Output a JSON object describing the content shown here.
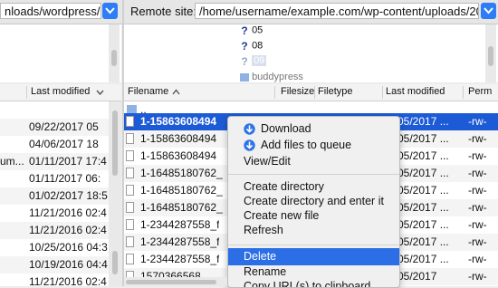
{
  "local": {
    "path_value": "nloads/wordpress/",
    "headers": {
      "last_modified": "Last modified"
    },
    "rows": [
      {
        "name": "",
        "modified": ""
      },
      {
        "name": "",
        "modified": "09/22/2017 05"
      },
      {
        "name": "",
        "modified": "04/06/2017 18"
      },
      {
        "name": "um...",
        "modified": "01/11/2017 17:4"
      },
      {
        "name": "",
        "modified": "01/11/2017 06:"
      },
      {
        "name": "",
        "modified": "01/02/2017 18:5"
      },
      {
        "name": "",
        "modified": "11/21/2016 02:4"
      },
      {
        "name": "",
        "modified": "11/21/2016 02:4"
      },
      {
        "name": "",
        "modified": "10/25/2016 04:3"
      },
      {
        "name": "",
        "modified": "10/19/2016 04:4"
      },
      {
        "name": "",
        "modified": "11/21/2016 02:4"
      }
    ]
  },
  "remote": {
    "site_label": "Remote site:",
    "path_value": "/home/username/example.com/wp-content/uploads/20",
    "tree": [
      {
        "label": "05",
        "icon": "question-folder-icon"
      },
      {
        "label": "08",
        "icon": "question-folder-icon"
      },
      {
        "label": "09",
        "icon": "question-folder-icon"
      },
      {
        "label": "buddypress",
        "icon": "folder-icon"
      }
    ],
    "headers": {
      "filename": "Filename",
      "sort_arrow": "^",
      "filesize": "Filesize",
      "filetype": "Filetype",
      "last_modified": "Last modified",
      "permissions": "Perm"
    },
    "rows": [
      {
        "name": "..",
        "modified": "",
        "perm": "",
        "folder": true,
        "selected": false
      },
      {
        "name": "1-15863608494",
        "modified": "05/2017 ...",
        "perm": "-rw-",
        "selected": true
      },
      {
        "name": "1-15863608494",
        "modified": "05/2017 ...",
        "perm": "-rw-",
        "selected": false
      },
      {
        "name": "1-15863608494",
        "modified": "05/2017 ...",
        "perm": "-rw-",
        "selected": false
      },
      {
        "name": "1-16485180762_",
        "modified": "05/2017 ...",
        "perm": "-rw-",
        "selected": false
      },
      {
        "name": "1-16485180762_",
        "modified": "05/2017 ...",
        "perm": "-rw-",
        "selected": false
      },
      {
        "name": "1-16485180762_",
        "modified": "05/2017 ...",
        "perm": "-rw-",
        "selected": false
      },
      {
        "name": "1-2344287558_f",
        "modified": "05/2017 ...",
        "perm": "-rw-",
        "selected": false
      },
      {
        "name": "1-2344287558_f",
        "modified": "05/2017 ...",
        "perm": "-rw-",
        "selected": false
      },
      {
        "name": "1-2344287558_f",
        "modified": "05/2017 ...",
        "perm": "-rw-",
        "selected": false
      },
      {
        "name": "1570366568...",
        "modified": "05/2017",
        "perm": "-rw-",
        "selected": false
      }
    ]
  },
  "context_menu": {
    "download": "Download",
    "add_to_queue": "Add files to queue",
    "view_edit": "View/Edit",
    "create_dir": "Create directory",
    "create_dir_enter": "Create directory and enter it",
    "create_file": "Create new file",
    "refresh": "Refresh",
    "delete": "Delete",
    "rename": "Rename",
    "copy_url": "Copy URL(s) to clipboard"
  },
  "colors": {
    "selection": "#1d5bd6",
    "menu_highlight": "#2b6ee6",
    "accent": "#2e7cf6"
  }
}
